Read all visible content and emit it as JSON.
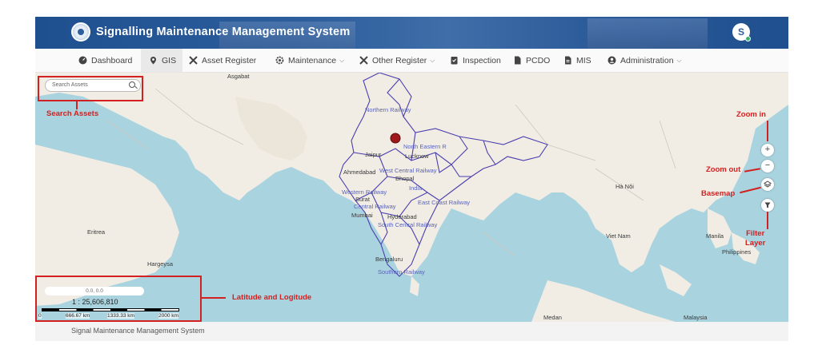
{
  "header": {
    "app_title": "Signalling Maintenance Management System",
    "avatar_initial": "S"
  },
  "nav": {
    "items": [
      {
        "label": "Dashboard",
        "icon": "dashboard-icon"
      },
      {
        "label": "GIS",
        "icon": "location-pin-icon",
        "active": true
      },
      {
        "label": "Asset Register",
        "icon": "tools-icon"
      },
      {
        "label": "Maintenance",
        "icon": "gear-icon",
        "dropdown": true
      },
      {
        "label": "Other Register",
        "icon": "tools-icon",
        "dropdown": true
      },
      {
        "label": "Inspection",
        "icon": "clipboard-check-icon"
      },
      {
        "label": "PCDO",
        "icon": "document-icon"
      },
      {
        "label": "MIS",
        "icon": "report-icon"
      },
      {
        "label": "Administration",
        "icon": "user-circle-icon",
        "dropdown": true
      }
    ]
  },
  "map": {
    "search_placeholder": "Search Assets",
    "zoom_in": "+",
    "zoom_out": "−",
    "coordinates": "0.0, 0.0",
    "scale_ratio": "1 : 25,606,810",
    "scale_ticks": [
      "0",
      "666.67 km",
      "1333.33 km",
      "2000 km"
    ],
    "labels": {
      "north_railway": "Northern Railway",
      "north_eastern": "North Eastern R",
      "jaipur": "Jaipur",
      "lucknow": "Lucknow",
      "ahmedabad": "Ahmedabad",
      "bhopal": "Bhopal",
      "west_central": "West Central Railway",
      "india": "India",
      "western_railway": "Western Railway",
      "surat": "Surat",
      "central_railway": "Central Railway",
      "east_coast": "East Coast Railway",
      "mumbai": "Mumbai",
      "hyderabad": "Hyderabad",
      "south_central": "South Central Railway",
      "bengaluru": "Bengaluru",
      "southern_railway": "Southern Railway",
      "hargeysa": "Hargeysa",
      "eritrea": "Eritrea",
      "viet_nam": "Viet Nam",
      "ha_noi": "Hà Nội",
      "manila": "Manila",
      "philippines": "Philippines",
      "medan": "Medan",
      "malaysia": "Malaysia",
      "asgabat": "Asgabat"
    }
  },
  "annotations": {
    "search_assets": "Search Assets",
    "zoom_in": "Zoom in",
    "zoom_out": "Zoom out",
    "basemap": "Basemap",
    "filter_layer": "Filter\nLayer",
    "lat_long": "Latitude and Logitude"
  },
  "footer": {
    "text": "Signal Maintenance Management System"
  },
  "colors": {
    "header": "#2c5d9c",
    "annotation": "#d32020",
    "water": "#a9d3df",
    "land": "#f0ece4",
    "rail": "#4b3fae"
  }
}
